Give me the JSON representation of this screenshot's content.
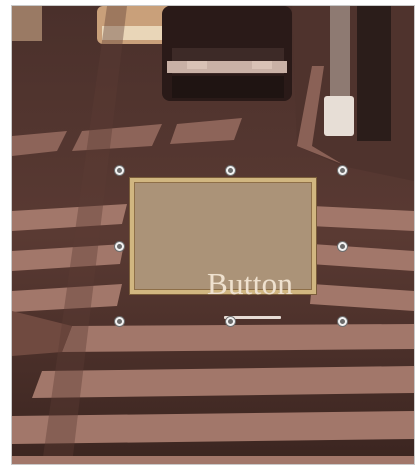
{
  "canvas": {
    "button": {
      "label": "Button"
    },
    "selection_handles": [
      "top-left",
      "top-center",
      "top-right",
      "middle-left",
      "middle-right",
      "bottom-left",
      "bottom-center",
      "bottom-right"
    ]
  }
}
